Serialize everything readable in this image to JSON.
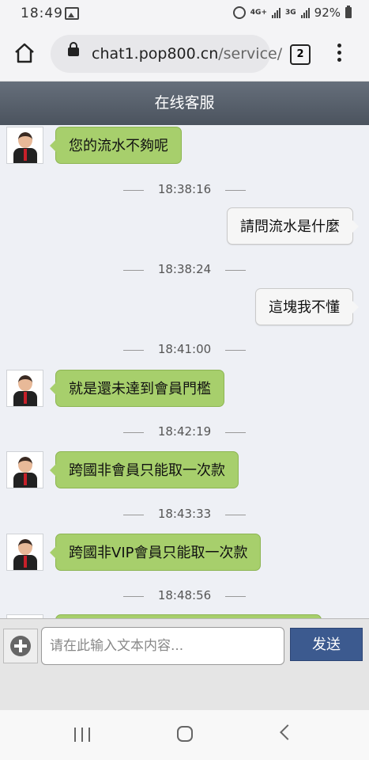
{
  "status": {
    "time": "18:49",
    "network_1": "4G+",
    "network_2": "3G",
    "battery": "92%"
  },
  "browser": {
    "url_main": "chat1.pop800.cn",
    "url_path": "/service/",
    "tab_count": "2"
  },
  "header": {
    "title": "在线客服"
  },
  "messages": [
    {
      "side": "left",
      "text": "您的流水不夠呢"
    },
    {
      "type": "time",
      "text": "18:38:16"
    },
    {
      "side": "right",
      "text": "請問流水是什麼"
    },
    {
      "type": "time",
      "text": "18:38:24"
    },
    {
      "side": "right",
      "text": "這塊我不懂"
    },
    {
      "type": "time",
      "text": "18:41:00"
    },
    {
      "side": "left",
      "text": "就是還未達到會員門檻"
    },
    {
      "type": "time",
      "text": "18:42:19"
    },
    {
      "side": "left",
      "text": "跨國非會員只能取一次款"
    },
    {
      "type": "time",
      "text": "18:43:33"
    },
    {
      "side": "left",
      "text": "跨國非VIP會員只能取一次款"
    },
    {
      "type": "time",
      "text": "18:48:56"
    }
  ],
  "input": {
    "placeholder": "请在此输入文本内容...",
    "send_label": "发送"
  },
  "colors": {
    "agent_bubble": "#a7cf6c",
    "user_bubble": "#f6f6f6",
    "header_bg": "#4b535e",
    "send_button": "#3c5a8f"
  }
}
